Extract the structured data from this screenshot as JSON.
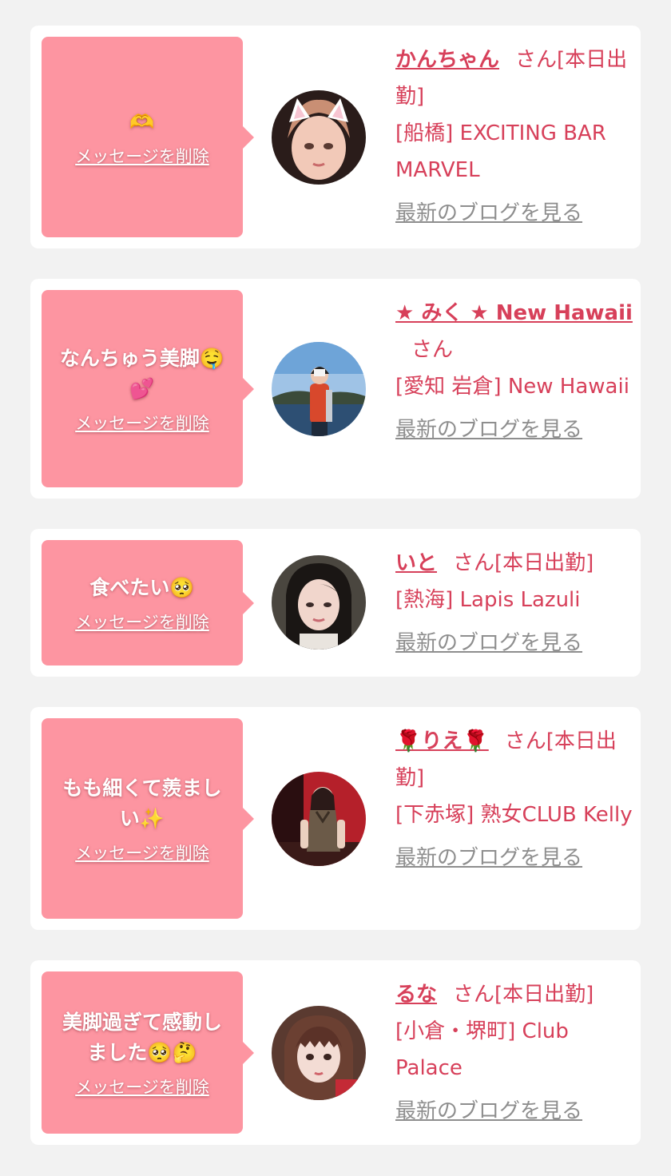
{
  "messages": [
    {
      "message": "🫶",
      "delete_label": "メッセージを削除",
      "cast_name": "かんちゃん",
      "san_suffix": "さん[本日出勤]",
      "shop": "[船橋] EXCITING BAR MARVEL",
      "blog_label": "最新のブログを見る"
    },
    {
      "message": "なんちゅう美脚🤤💕",
      "delete_label": "メッセージを削除",
      "cast_name": "★ みく ★ New Hawaii",
      "san_suffix": "さん",
      "shop": "[愛知 岩倉] New Hawaii",
      "blog_label": "最新のブログを見る"
    },
    {
      "message": "食べたい🥺",
      "delete_label": "メッセージを削除",
      "cast_name": "いと",
      "san_suffix": "さん[本日出勤]",
      "shop": "[熱海] Lapis Lazuli",
      "blog_label": "最新のブログを見る"
    },
    {
      "message": "もも細くて羨ましい✨",
      "delete_label": "メッセージを削除",
      "cast_name": "🌹りえ🌹",
      "san_suffix": "さん[本日出勤]",
      "shop": "[下赤塚] 熟女CLUB Kelly",
      "blog_label": "最新のブログを見る"
    },
    {
      "message": "美脚過ぎて感動しました🥺🤔",
      "delete_label": "メッセージを削除",
      "cast_name": "るな",
      "san_suffix": "さん[本日出勤]",
      "shop": "[小倉・堺町] Club Palace",
      "blog_label": "最新のブログを見る"
    }
  ]
}
